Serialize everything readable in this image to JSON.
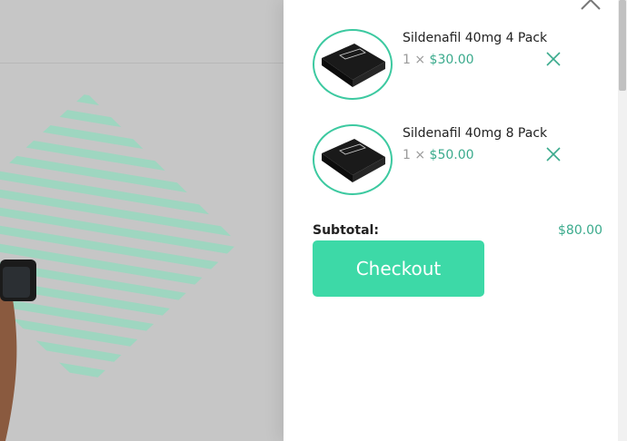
{
  "cart": {
    "items": [
      {
        "name": "Sildenafil 40mg 4 Pack",
        "qty_prefix": "1 ×",
        "price": "$30.00"
      },
      {
        "name": "Sildenafil 40mg 8 Pack",
        "qty_prefix": "1 ×",
        "price": "$50.00"
      }
    ],
    "subtotal_label": "Subtotal:",
    "subtotal_value": "$80.00",
    "checkout_label": "Checkout"
  },
  "colors": {
    "accent": "#3dd9a7",
    "price_text": "#3aaa8c",
    "overlay": "#c6c6c6"
  },
  "icons": [
    "close-icon",
    "remove-item-icon"
  ]
}
